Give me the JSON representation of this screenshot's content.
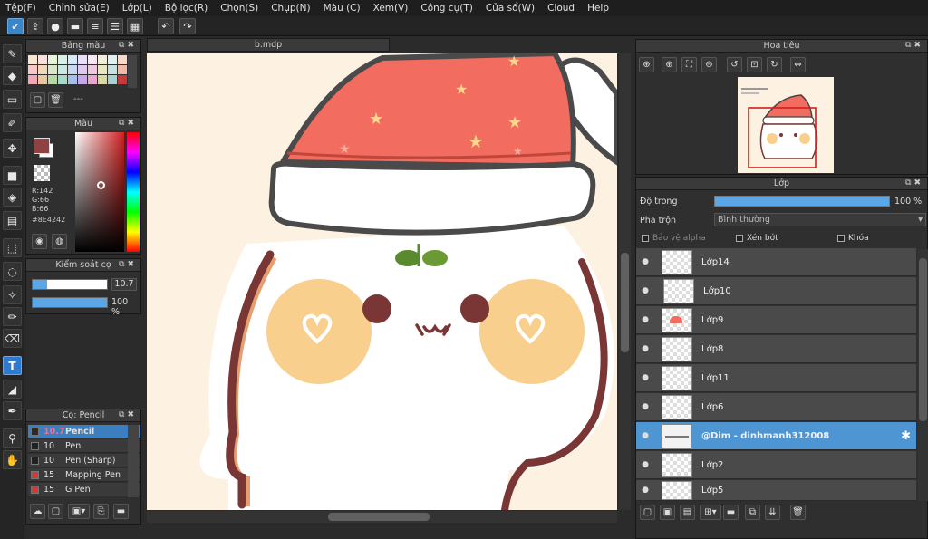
{
  "menu": [
    "Tệp(F)",
    "Chỉnh sửa(E)",
    "Lớp(L)",
    "Bộ lọc(R)",
    "Chọn(S)",
    "Chụp(N)",
    "Màu (C)",
    "Xem(V)",
    "Công cụ(T)",
    "Cửa sổ(W)",
    "Cloud",
    "Help"
  ],
  "document": {
    "tab": "b.mdp"
  },
  "panels": {
    "palette": {
      "title": "Bảng màu",
      "dashes": "---"
    },
    "color": {
      "title": "Màu",
      "r": "R:142",
      "g": "G:66",
      "b": "B:66",
      "hex": "#8E4242",
      "fg": "#8E4242"
    },
    "brush_control": {
      "title": "Kiểm soát cọ",
      "size": "10.7",
      "opacity": "100 %"
    },
    "brush_list": {
      "title": "Cọ: Pencil",
      "items": [
        {
          "size": "10.7",
          "name": "Pencil",
          "color": "#2a2a2a"
        },
        {
          "size": "10",
          "name": "Pen",
          "color": "#222222"
        },
        {
          "size": "10",
          "name": "Pen (Sharp)",
          "color": "#222222"
        },
        {
          "size": "15",
          "name": "Mapping Pen",
          "color": "#d23a3a"
        },
        {
          "size": "15",
          "name": "G Pen",
          "color": "#d23a3a"
        }
      ]
    },
    "navigator": {
      "title": "Hoa tiêu"
    },
    "layers": {
      "title": "Lớp",
      "opacity_label": "Độ trong",
      "opacity_value": "100 %",
      "blend_label": "Pha trộn",
      "blend_value": "Bình thường",
      "protect_alpha": "Bảo vệ alpha",
      "clipping": "Xén bớt",
      "lock": "Khóa",
      "items": [
        {
          "name": "Lớp14"
        },
        {
          "name": "Lớp10"
        },
        {
          "name": "Lớp9"
        },
        {
          "name": "Lớp8"
        },
        {
          "name": "Lớp11"
        },
        {
          "name": "Lớp6"
        },
        {
          "name": "@Dim - dinhmanh312008"
        },
        {
          "name": "Lớp2"
        },
        {
          "name": "Lớp5"
        }
      ]
    }
  },
  "colors": {
    "accent": "#3b86c8",
    "hat": "#f26d5f",
    "cheek": "#f9cf8e",
    "outline": "#7a3535",
    "leaf": "#5a8a2e",
    "canvas_bg": "#fdf1e2"
  }
}
